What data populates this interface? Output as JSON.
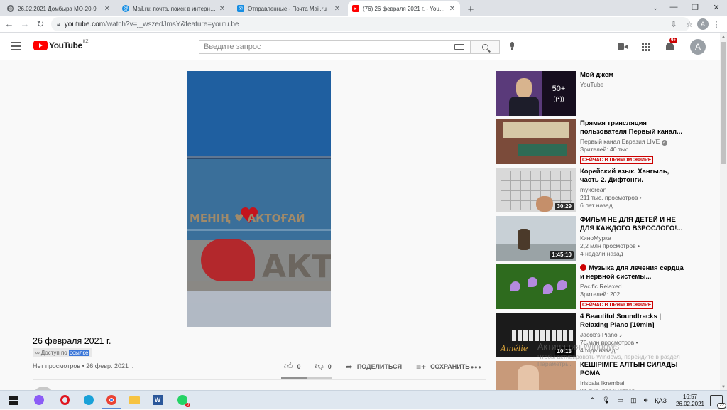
{
  "browser": {
    "tabs": [
      {
        "title": "26.02.2021 Домбыра МО-20-9",
        "favicon_color": "#5f6368"
      },
      {
        "title": "Mail.ru: почта, поиск в интернете",
        "favicon_color": "#168de2"
      },
      {
        "title": "Отправленные - Почта Mail.ru",
        "favicon_color": "#168de2"
      },
      {
        "title": "(76) 26 февраля 2021 г. - YouTube",
        "favicon_color": "#ff0000"
      }
    ],
    "url_host": "youtube.com",
    "url_rest": "/watch?v=j_wszedJmsY&feature=youtu.be",
    "profile_initial": "A"
  },
  "youtube": {
    "logo_text": "YouTube",
    "logo_country": "KZ",
    "search_placeholder": "Введите запрос",
    "notification_count": "9+",
    "avatar_initial": "A"
  },
  "video": {
    "title": "26 февраля 2021 г.",
    "access_prefix": "Доступ по",
    "access_highlight": "ссылке",
    "info": "Нет просмотров • 26 февр. 2021 г.",
    "likes": "0",
    "dislikes": "0",
    "share_label": "ПОДЕЛИТЬСЯ",
    "save_label": "СОХРАНИТЬ",
    "sign_text": "МЕНІҢ ♥ АКТОҒАЙ"
  },
  "recommendations": [
    {
      "title": "Мой джем",
      "channel": "YouTube",
      "meta2": "",
      "meta3": "",
      "badge": "",
      "duration": "",
      "mix_count": "50+"
    },
    {
      "title": "Прямая трансляция пользователя Первый канал...",
      "channel": "Первый канал Евразия LIVE",
      "meta2": "Зрителей: 40 тыс.",
      "meta3": "",
      "badge": "СЕЙЧАС В ПРЯМОМ ЭФИРЕ",
      "duration": "",
      "mix_count": ""
    },
    {
      "title": "Корейский язык. Хангыль, часть 2. Дифтонги.",
      "channel": "mykorean",
      "meta2": "211 тыс. просмотров •",
      "meta3": "6 лет назад",
      "badge": "",
      "duration": "30:29",
      "mix_count": ""
    },
    {
      "title": "ФИЛЬМ НЕ ДЛЯ ДЕТЕЙ И НЕ ДЛЯ КАЖДОГО ВЗРОСЛОГО!...",
      "channel": "КиноМурка",
      "meta2": "2,2 млн просмотров •",
      "meta3": "4 недели назад",
      "badge": "",
      "duration": "1:45:10",
      "mix_count": ""
    },
    {
      "title": "Музыка для лечения сердца и нервной системы...",
      "channel": "Pacific Relaxed",
      "meta2": "Зрителей: 202",
      "meta3": "",
      "badge": "СЕЙЧАС В ПРЯМОМ ЭФИРЕ",
      "duration": "",
      "mix_count": ""
    },
    {
      "title": "4 Beautiful Soundtracks | Relaxing Piano [10min]",
      "channel": "Jacob's Piano ♪",
      "meta2": "76 млн просмотров •",
      "meta3": "4 года назад",
      "badge": "",
      "duration": "10:13",
      "mix_count": ""
    },
    {
      "title": "КЕШІРІМГЕ АЛТЫН СИЛАДЫ РОМА",
      "channel": "Irisbala Ikrambai",
      "meta2": "81 тыс. просмотров •",
      "meta3": "",
      "badge": "",
      "duration": "",
      "mix_count": ""
    }
  ],
  "thumbnail_text": {
    "amelie": "Amélie"
  },
  "watermark": {
    "line1": "Активация Windows",
    "line2": "Чтобы активировать Windows, перейдите в раздел",
    "line3": "Параметры."
  },
  "taskbar": {
    "time": "16:57",
    "date": "26.02.2021",
    "lang": "ҚАЗ",
    "notifications": "22"
  }
}
